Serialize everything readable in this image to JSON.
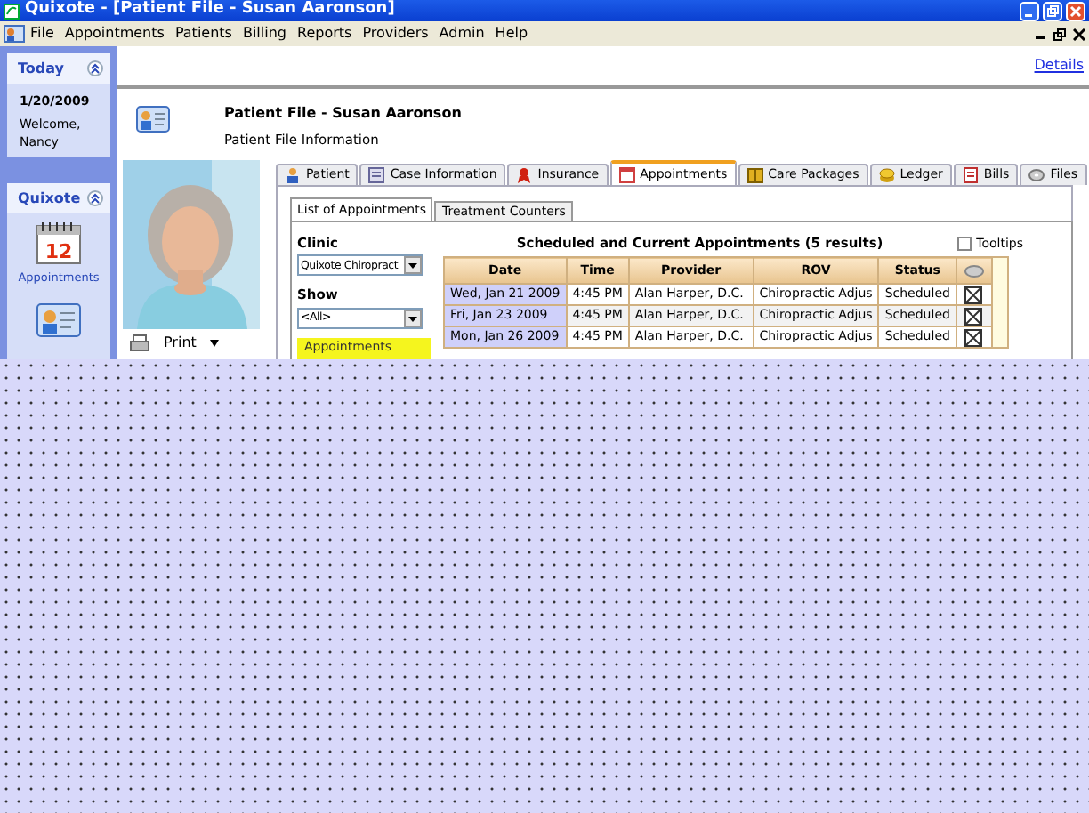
{
  "window": {
    "title": "Quixote - [Patient File - Susan Aaronson]"
  },
  "menu": [
    "File",
    "Appointments",
    "Patients",
    "Billing",
    "Reports",
    "Providers",
    "Admin",
    "Help"
  ],
  "sidebar": {
    "today": {
      "title": "Today",
      "date": "1/20/2009",
      "welcome": "Welcome, Nancy"
    },
    "quixote": {
      "title": "Quixote",
      "items": [
        {
          "kind": "calendar",
          "day": "12",
          "label": "Appointments"
        },
        {
          "kind": "card"
        }
      ]
    }
  },
  "header": {
    "link": "Details"
  },
  "patient": {
    "title": "Patient File - Susan Aaronson",
    "subtitle": "Patient File Information",
    "print": "Print"
  },
  "tabs": [
    {
      "label": "Patient",
      "selected": false
    },
    {
      "label": "Case Information",
      "selected": false
    },
    {
      "label": "Insurance",
      "selected": false
    },
    {
      "label": "Appointments",
      "selected": true
    },
    {
      "label": "Care Packages",
      "selected": false
    },
    {
      "label": "Ledger",
      "selected": false
    },
    {
      "label": "Bills",
      "selected": false
    },
    {
      "label": "Files",
      "selected": false
    }
  ],
  "subtabs": [
    {
      "label": "List of Appointments",
      "selected": true
    },
    {
      "label": "Treatment Counters",
      "selected": false
    }
  ],
  "filters": {
    "clinic_label": "Clinic",
    "clinic_value": "Quixote Chiropract",
    "show_label": "Show",
    "show_value": "<All>",
    "panel_title": "Appointments"
  },
  "table": {
    "title": "Scheduled and Current Appointments (5 results)",
    "tooltips": {
      "label": "Tooltips",
      "checked": false
    },
    "columns": [
      "Date",
      "Time",
      "Provider",
      "ROV",
      "Status"
    ],
    "rows": [
      {
        "date": "Wed, Jan 21  2009",
        "time": "4:45 PM",
        "provider": "Alan Harper, D.C.",
        "rov": "Chiropractic Adjus",
        "status": "Scheduled"
      },
      {
        "date": "Fri, Jan 23  2009",
        "time": "4:45 PM",
        "provider": "Alan Harper, D.C.",
        "rov": "Chiropractic Adjus",
        "status": "Scheduled"
      },
      {
        "date": "Mon, Jan 26  2009",
        "time": "4:45 PM",
        "provider": "Alan Harper, D.C.",
        "rov": "Chiropractic Adjus",
        "status": "Scheduled"
      }
    ]
  }
}
